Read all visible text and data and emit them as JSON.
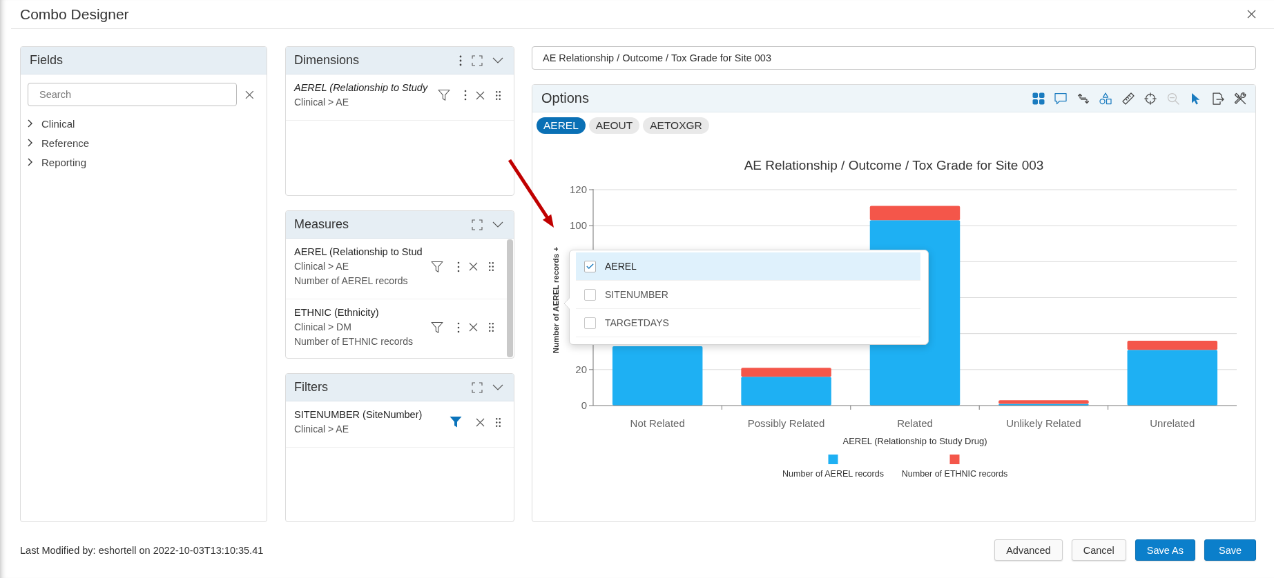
{
  "dialog": {
    "title": "Combo Designer"
  },
  "fields_panel": {
    "title": "Fields",
    "search": {
      "placeholder": "Search"
    },
    "tree": [
      {
        "label": "Clinical",
        "expanded": false
      },
      {
        "label": "Reference",
        "expanded": false
      },
      {
        "label": "Reporting",
        "expanded": false
      }
    ]
  },
  "dimensions": {
    "title": "Dimensions",
    "menu": true,
    "scrollable": false,
    "items": [
      {
        "name": "AEREL (Relationship to Study",
        "path": "Clinical > AE",
        "italic": true,
        "filtered": false,
        "menu": true
      }
    ]
  },
  "measures": {
    "title": "Measures",
    "menu": false,
    "scrollable": true,
    "items": [
      {
        "name": "AEREL (Relationship to Stud",
        "path": "Clinical > AE",
        "aggregate": "Number of AEREL records",
        "italic": false,
        "filtered": false,
        "menu": true
      },
      {
        "name": "ETHNIC (Ethnicity)",
        "path": "Clinical > DM",
        "aggregate": "Number of ETHNIC records",
        "italic": false,
        "filtered": false,
        "menu": true
      }
    ]
  },
  "filters": {
    "title": "Filters",
    "menu": false,
    "scrollable": false,
    "items": [
      {
        "name": "SITENUMBER (SiteNumber)",
        "path": "Clinical > AE",
        "italic": false,
        "filtered": true,
        "menu": false
      }
    ]
  },
  "title_field": {
    "value": "AE Relationship / Outcome / Tox Grade for Site 003"
  },
  "options": {
    "title": "Options",
    "toolbar": [
      {
        "kind": "grid",
        "active": true,
        "disabled": false
      },
      {
        "kind": "comment",
        "active": true,
        "disabled": false
      },
      {
        "kind": "swap",
        "active": false,
        "disabled": false
      },
      {
        "kind": "shapes",
        "active": true,
        "disabled": false
      },
      {
        "kind": "ruler",
        "active": false,
        "disabled": false
      },
      {
        "kind": "crosshair",
        "active": false,
        "disabled": false
      },
      {
        "kind": "zoom-out",
        "active": false,
        "disabled": true
      },
      {
        "kind": "pointer",
        "active": true,
        "disabled": false
      },
      {
        "kind": "export",
        "active": false,
        "disabled": false
      },
      {
        "kind": "tools",
        "active": false,
        "disabled": false
      }
    ],
    "tabs": [
      {
        "label": "AEREL",
        "selected": true
      },
      {
        "label": "AEOUT",
        "selected": false
      },
      {
        "label": "AETOXGR",
        "selected": false
      }
    ],
    "chart_data": {
      "type": "bar",
      "title": "AE Relationship / Outcome / Tox Grade for Site 003",
      "xlabel": "AEREL (Relationship to Study Drug)",
      "ylabel": "Number of AEREL records +",
      "categories": [
        "Not Related",
        "Possibly Related",
        "Related",
        "Unlikely Related",
        "Unrelated"
      ],
      "series": [
        {
          "name": "Number of AEREL records",
          "color": "#1eb0f3",
          "values": [
            33,
            16,
            103,
            1,
            31
          ]
        },
        {
          "name": "Number of ETHNIC records",
          "color": "#f4564a",
          "values": [
            null,
            5,
            8,
            2,
            5
          ]
        }
      ],
      "ylim": [
        0,
        120
      ],
      "yticks": [
        0,
        20,
        100,
        120
      ],
      "stacked": true,
      "legend": "bottom"
    },
    "series_menu": {
      "items": [
        {
          "label": "AEREL",
          "checked": true,
          "selected": true
        },
        {
          "label": "SITENUMBER",
          "checked": false,
          "selected": false
        },
        {
          "label": "TARGETDAYS",
          "checked": false,
          "selected": false
        }
      ]
    }
  },
  "footer": {
    "last_modified": "Last Modified by: eshortell on 2022-10-03T13:10:35.41",
    "buttons": [
      {
        "label": "Advanced",
        "primary": false
      },
      {
        "label": "Cancel",
        "primary": false
      },
      {
        "label": "Save As",
        "primary": true
      },
      {
        "label": "Save",
        "primary": true
      }
    ]
  }
}
